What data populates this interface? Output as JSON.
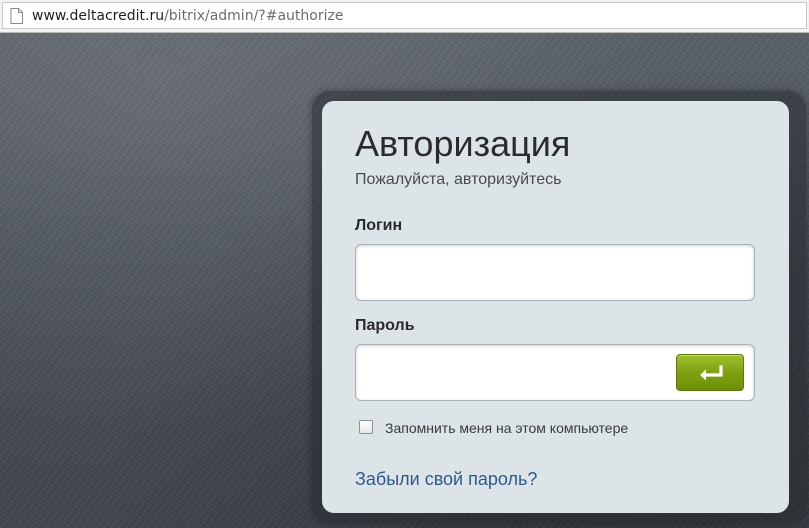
{
  "browser": {
    "url_domain": "www.deltacredit.ru",
    "url_path": "/bitrix/admin/?#authorize",
    "page_icon": "page-icon"
  },
  "auth": {
    "title": "Авторизация",
    "subtitle": "Пожалуйста, авторизуйтесь",
    "login_label": "Логин",
    "login_value": "",
    "password_label": "Пароль",
    "password_value": "",
    "submit_icon": "enter-return-icon",
    "remember_label": "Запомнить меня на этом компьютере",
    "remember_checked": false,
    "forgot_link": "Забыли свой пароль?"
  },
  "colors": {
    "background": "#4a5058",
    "dialog": "#dce4e8",
    "submit_green": "#7ea112",
    "link_blue": "#2c5a8f"
  }
}
